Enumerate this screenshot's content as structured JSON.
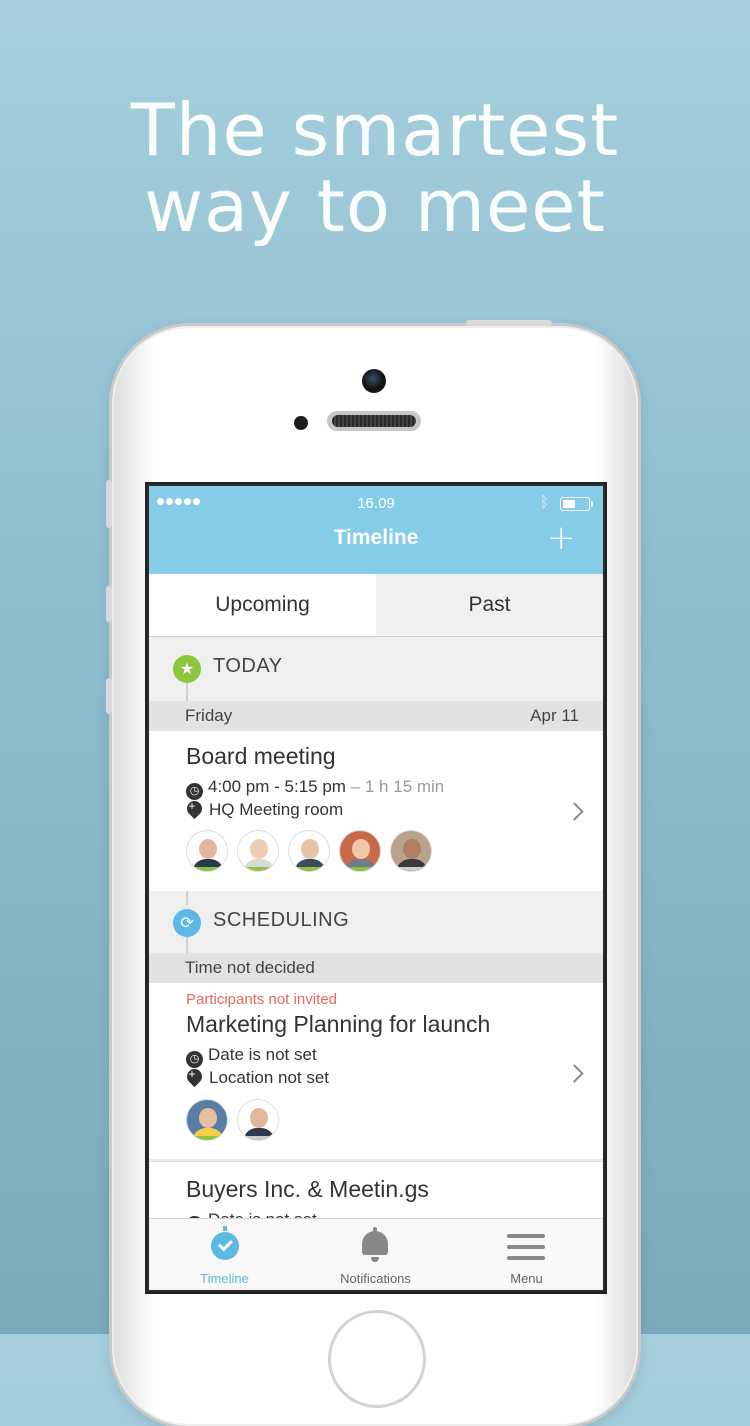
{
  "headline": {
    "line1": "The smartest",
    "line2": "way to meet"
  },
  "status_bar": {
    "time": "16.09",
    "signal_icon": "signal-dots-icon",
    "bluetooth_icon": "bluetooth-icon",
    "battery_icon": "battery-icon"
  },
  "nav": {
    "title": "Timeline",
    "add_icon": "+"
  },
  "tabs": [
    {
      "label": "Upcoming",
      "selected": true
    },
    {
      "label": "Past",
      "selected": false
    }
  ],
  "sections": {
    "today": {
      "label": "TODAY",
      "icon": "star-icon",
      "color": "#8cc63f",
      "day": "Friday",
      "date": "Apr 11"
    },
    "scheduling": {
      "label": "SCHEDULING",
      "icon": "sync-icon",
      "color": "#5cb8e4",
      "day": "Time not decided"
    }
  },
  "meetings": [
    {
      "title": "Board meeting",
      "time": "4:00 pm - 5:15 pm",
      "duration": "– 1 h 15 min",
      "location": "HQ Meeting room"
    },
    {
      "warning": "Participants not invited",
      "title": "Marketing Planning for launch",
      "date": "Date is not set",
      "location": "Location not set"
    },
    {
      "title": "Buyers Inc. & Meetin.gs",
      "date": "Date is not set"
    }
  ],
  "bottom_nav": [
    {
      "label": "Timeline",
      "icon": "timeline-clock-icon",
      "active": true
    },
    {
      "label": "Notifications",
      "icon": "bell-icon",
      "active": false
    },
    {
      "label": "Menu",
      "icon": "menu-icon",
      "active": false
    }
  ],
  "colors": {
    "accent": "#84cce8",
    "active": "#5cb8e4",
    "warning": "#e4685f",
    "status_ok": "#8cc63f"
  }
}
